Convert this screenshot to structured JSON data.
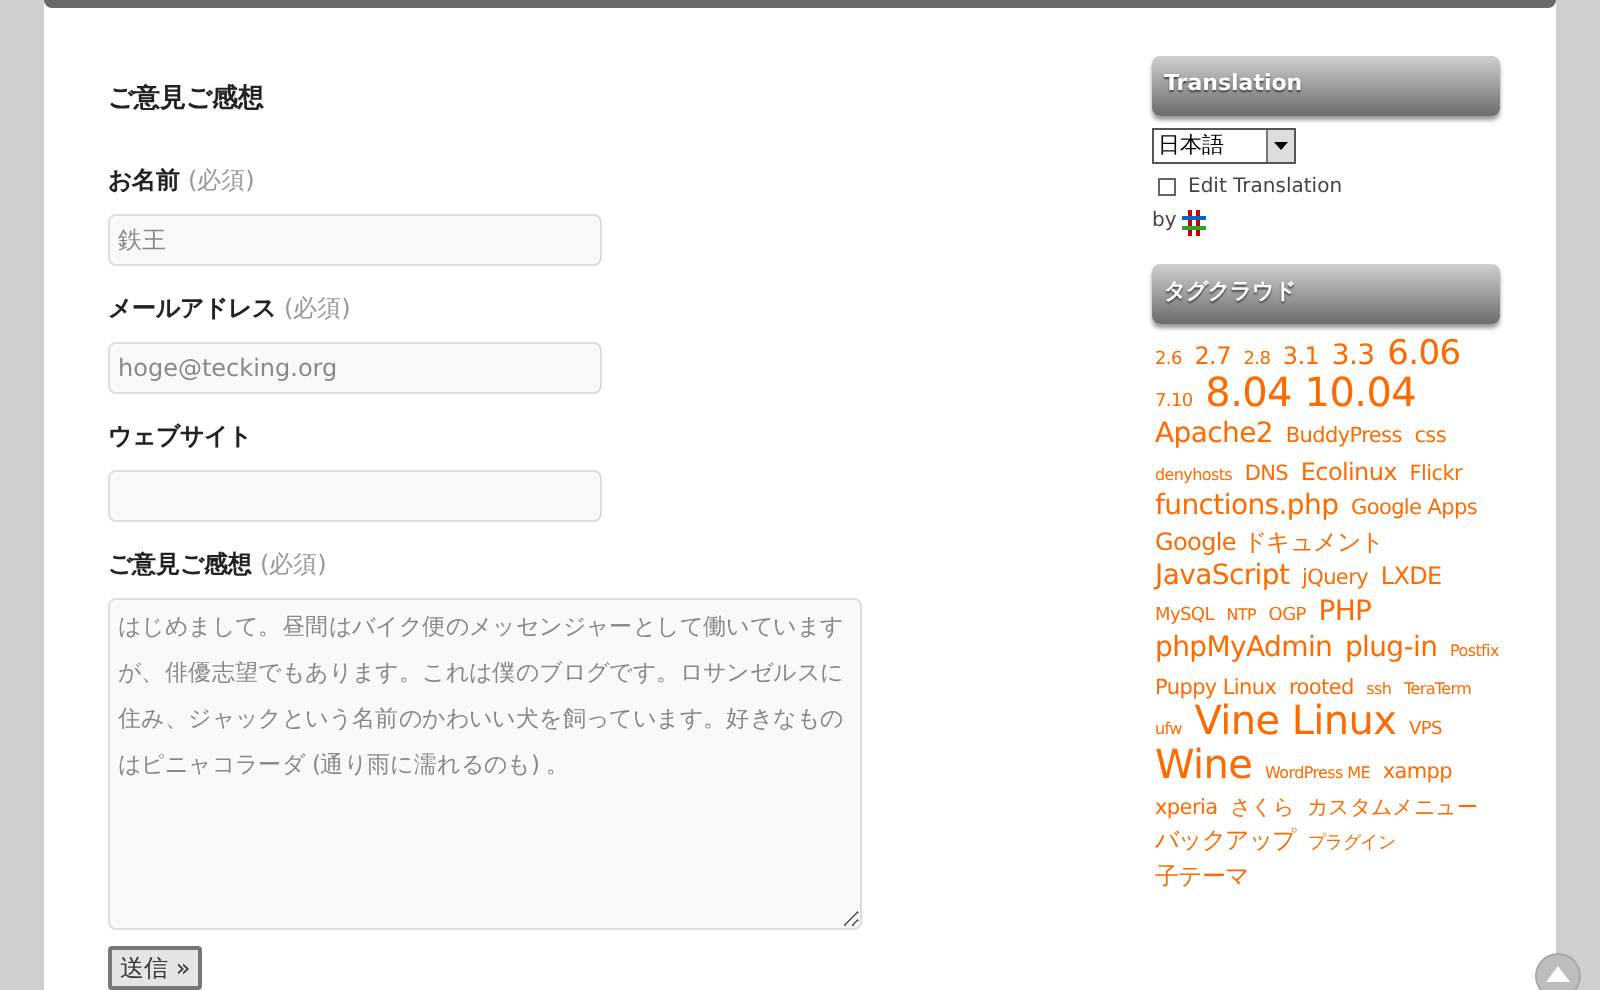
{
  "form": {
    "title": "ご意見ご感想",
    "fields": [
      {
        "kind": "input",
        "label": "お名前",
        "required_note": "(必須)",
        "value": "鉄王"
      },
      {
        "kind": "input",
        "label": "メールアドレス",
        "required_note": "(必須)",
        "value": "hoge@tecking.org"
      },
      {
        "kind": "input",
        "label": "ウェブサイト"
      },
      {
        "kind": "textarea",
        "label": "ご意見ご感想",
        "required_note": "(必須)",
        "value": "はじめまして。昼間はバイク便のメッセンジャーとして働いていますが、俳優志望でもあります。これは僕のブログです。ロサンゼルスに住み、ジャックという名前のかわいい犬を飼っています。好きなものはピニャコラーダ (通り雨に濡れるのも) 。"
      }
    ],
    "submit": "送信 »"
  },
  "sidebar": {
    "translation": {
      "title": "Translation",
      "language": "日本語",
      "edit_label": "Edit Translation",
      "edit_checked": false,
      "by": "by"
    },
    "tag_cloud": {
      "title": "タグクラウド",
      "tags": [
        {
          "label": "2.6",
          "kind": "xs"
        },
        {
          "label": "2.7",
          "kind": "m"
        },
        {
          "label": "2.8",
          "kind": "xs"
        },
        {
          "label": "3.1",
          "kind": "m"
        },
        {
          "label": "3.3",
          "kind": "l"
        },
        {
          "label": "6.06",
          "kind": "xl"
        },
        {
          "label": "7.10",
          "kind": "xs"
        },
        {
          "label": "8.04",
          "kind": "xxl"
        },
        {
          "label": "10.04",
          "kind": "xxl"
        },
        {
          "label": "Apache2",
          "kind": "l"
        },
        {
          "label": "BuddyPress",
          "kind": "s"
        },
        {
          "label": "css",
          "kind": "s"
        },
        {
          "label": "denyhosts",
          "kind": "xxs"
        },
        {
          "label": "DNS",
          "kind": "s"
        },
        {
          "label": "Ecolinux",
          "kind": "m"
        },
        {
          "label": "Flickr",
          "kind": "s"
        },
        {
          "label": "functions.php",
          "kind": "l"
        },
        {
          "label": "Google Apps",
          "kind": "s"
        },
        {
          "label": "Google ドキュメント",
          "kind": "m"
        },
        {
          "label": "JavaScript",
          "kind": "l"
        },
        {
          "label": "jQuery",
          "kind": "s"
        },
        {
          "label": "LXDE",
          "kind": "m"
        },
        {
          "label": "MySQL",
          "kind": "xs"
        },
        {
          "label": "NTP",
          "kind": "xxs"
        },
        {
          "label": "OGP",
          "kind": "xs"
        },
        {
          "label": "PHP",
          "kind": "l"
        },
        {
          "label": "phpMyAdmin",
          "kind": "l"
        },
        {
          "label": "plug-in",
          "kind": "l"
        },
        {
          "label": "Postfix",
          "kind": "xxs"
        },
        {
          "label": "Puppy Linux",
          "kind": "s"
        },
        {
          "label": "rooted",
          "kind": "s"
        },
        {
          "label": "ssh",
          "kind": "xxs"
        },
        {
          "label": "TeraTerm",
          "kind": "xxs"
        },
        {
          "label": "ufw",
          "kind": "xxs"
        },
        {
          "label": "Vine Linux",
          "kind": "xxl"
        },
        {
          "label": "VPS",
          "kind": "xs"
        },
        {
          "label": "Wine",
          "kind": "xxl"
        },
        {
          "label": "WordPress ME",
          "kind": "xxs"
        },
        {
          "label": "xampp",
          "kind": "s"
        },
        {
          "label": "xperia",
          "kind": "s"
        },
        {
          "label": "さくら",
          "kind": "s"
        },
        {
          "label": "カスタムメニュー",
          "kind": "s"
        },
        {
          "label": "バックアップ",
          "kind": "m"
        },
        {
          "label": "プラグイン",
          "kind": "xs"
        },
        {
          "label": "子テーマ",
          "kind": "m"
        }
      ]
    }
  }
}
